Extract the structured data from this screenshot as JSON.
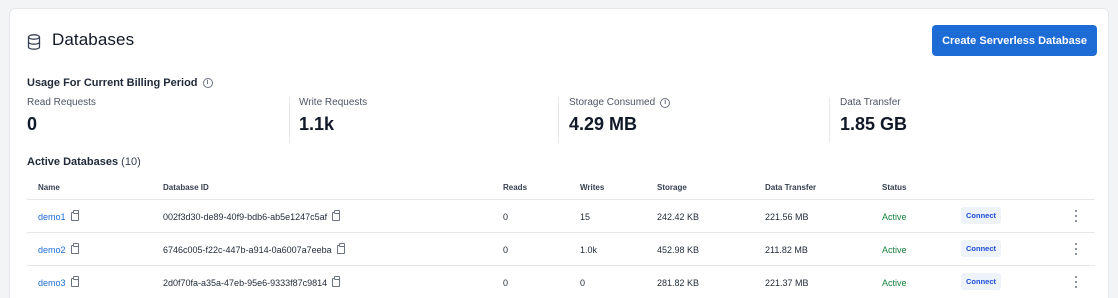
{
  "header": {
    "title": "Databases",
    "icon": "database-icon",
    "create_button_label": "Create Serverless Database",
    "accent_color": "#1d6bd4"
  },
  "usage": {
    "title": "Usage For Current Billing Period",
    "metrics": [
      {
        "label": "Read Requests",
        "value": "0"
      },
      {
        "label": "Write Requests",
        "value": "1.1k"
      },
      {
        "label": "Storage Consumed",
        "value": "4.29 MB"
      },
      {
        "label": "Data Transfer",
        "value": "1.85 GB"
      }
    ]
  },
  "active_databases": {
    "title": "Active Databases",
    "count": "(10)",
    "columns": [
      "Name",
      "Database ID",
      "Reads",
      "Writes",
      "Storage",
      "Data Transfer",
      "Status"
    ],
    "rows": [
      {
        "name": "demo1",
        "id": "002f3d30-de89-40f9-bdb6-ab5e1247c5af",
        "reads": "0",
        "writes": "15",
        "storage": "242.42 KB",
        "transfer": "221.56 MB",
        "status": "Active",
        "action": "Connect"
      },
      {
        "name": "demo2",
        "id": "6746c005-f22c-447b-a914-0a6007a7eeba",
        "reads": "0",
        "writes": "1.0k",
        "storage": "452.98 KB",
        "transfer": "211.82 MB",
        "status": "Active",
        "action": "Connect"
      },
      {
        "name": "demo3",
        "id": "2d0f70fa-a35a-47eb-95e6-9333f87c9814",
        "reads": "0",
        "writes": "0",
        "storage": "281.82 KB",
        "transfer": "221.37 MB",
        "status": "Active",
        "action": "Connect"
      }
    ]
  }
}
